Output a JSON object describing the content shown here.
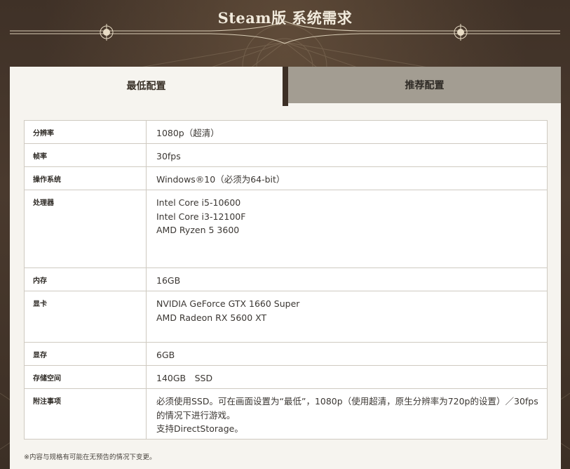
{
  "page": {
    "title": "Steam版 系统需求"
  },
  "tabs": {
    "minimum": "最低配置",
    "recommended": "推荐配置"
  },
  "specs": {
    "resolution": {
      "label": "分辨率",
      "value": "1080p（超清）"
    },
    "framerate": {
      "label": "帧率",
      "value": "30fps"
    },
    "os": {
      "label": "操作系统",
      "value": "Windows®10（必须为64-bit）"
    },
    "cpu": {
      "label": "处理器",
      "lines": [
        "Intel Core i5-10600",
        "Intel Core i3-12100F",
        "AMD Ryzen 5 3600"
      ]
    },
    "memory": {
      "label": "内存",
      "value": "16GB"
    },
    "gpu": {
      "label": "显卡",
      "lines": [
        "NVIDIA GeForce GTX 1660 Super",
        "AMD Radeon RX 5600 XT"
      ]
    },
    "vram": {
      "label": "显存",
      "value": "6GB"
    },
    "storage": {
      "label": "存储空间",
      "value": "140GB　SSD"
    },
    "notes": {
      "label": "附注事项",
      "lines": [
        "必须使用SSD。可在画面设置为“最低”，1080p（使用超清，原生分辨率为720p的设置）／30fps",
        "的情况下进行游戏。",
        "支持DirectStorage。"
      ]
    }
  },
  "footnote": "※内容与规格有可能在无预告的情况下变更。",
  "colors": {
    "background": "#3f3127",
    "panel": "#f6f4ef",
    "inactive_tab": "#a39d92",
    "title": "#f1eadc"
  },
  "icons": {
    "ornament_left": "ornament-icon",
    "ornament_right": "ornament-icon"
  }
}
